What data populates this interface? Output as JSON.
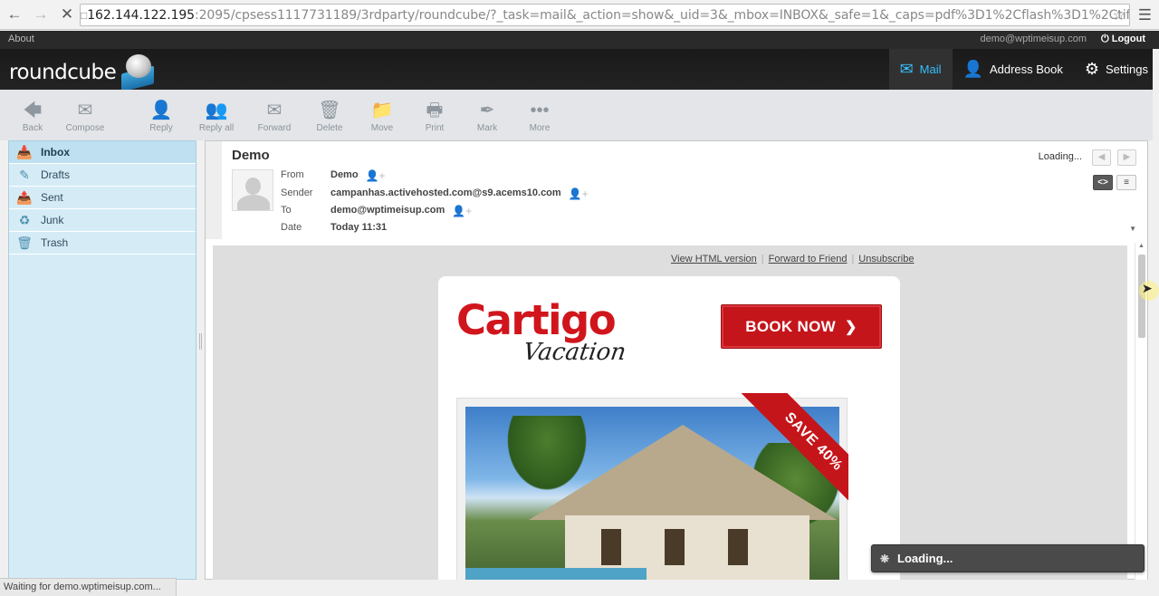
{
  "browser": {
    "url_host": "162.144.122.195",
    "url_rest": ":2095/cpsess1117731189/3rdparty/roundcube/?_task=mail&_action=show&_uid=3&_mbox=INBOX&_safe=1&_caps=pdf%3D1%2Cflash%3D1%2Ctif%3",
    "status": "Waiting for demo.wptimeisup.com..."
  },
  "topline": {
    "about": "About",
    "user": "demo@wptimeisup.com",
    "logout": "Logout"
  },
  "logo": {
    "text": "roundcube"
  },
  "tasks": [
    {
      "label": "Mail",
      "icon": "envelope-icon"
    },
    {
      "label": "Address Book",
      "icon": "person-icon"
    },
    {
      "label": "Settings",
      "icon": "gear-icon"
    }
  ],
  "toolbar": {
    "back": "Back",
    "compose": "Compose",
    "reply": "Reply",
    "reply_all": "Reply all",
    "forward": "Forward",
    "delete": "Delete",
    "move": "Move",
    "print": "Print",
    "mark": "Mark",
    "more": "More"
  },
  "folders": [
    {
      "label": "Inbox",
      "icon": "inbox-icon"
    },
    {
      "label": "Drafts",
      "icon": "pencil-icon"
    },
    {
      "label": "Sent",
      "icon": "sent-icon"
    },
    {
      "label": "Junk",
      "icon": "junk-icon"
    },
    {
      "label": "Trash",
      "icon": "trash-icon"
    }
  ],
  "message": {
    "subject": "Demo",
    "from_label": "From",
    "from": "Demo",
    "sender_label": "Sender",
    "sender": "campanhas.activehosted.com@s9.acems10.com",
    "to_label": "To",
    "to": "demo@wptimeisup.com",
    "date_label": "Date",
    "date": "Today 11:31",
    "loading": "Loading..."
  },
  "email": {
    "links": [
      "View HTML version",
      "Forward to Friend",
      "Unsubscribe"
    ],
    "brand_main": "Cartigo",
    "brand_sub": "Vacation",
    "book_now": "BOOK NOW",
    "ribbon": "SAVE 40%"
  },
  "toast": {
    "text": "Loading..."
  },
  "colors": {
    "accent": "#37beff",
    "brand_red": "#c4151b",
    "folder_bg": "#d5ecf7"
  }
}
